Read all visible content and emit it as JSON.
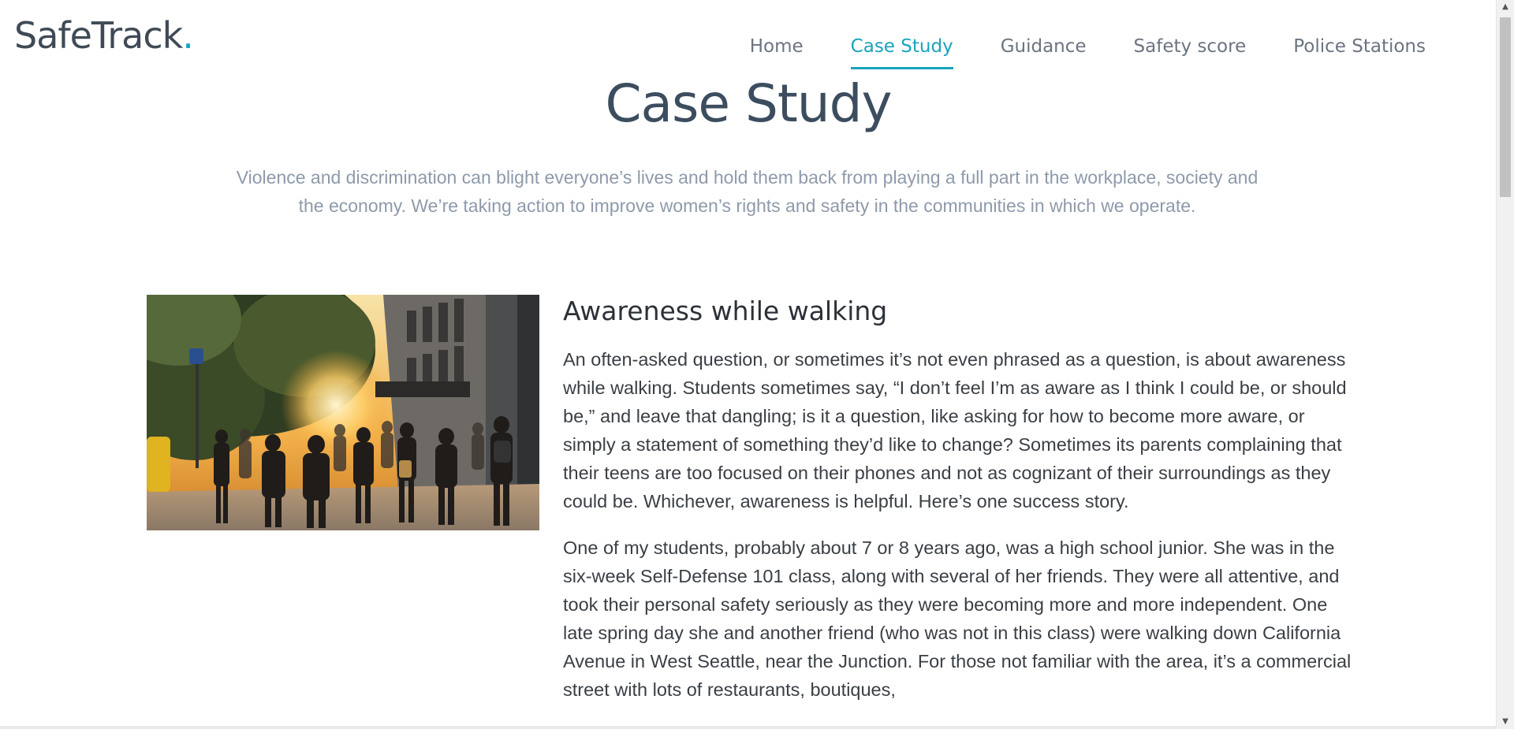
{
  "brand": {
    "name": "SafeTrack",
    "dot": ".",
    "accent_color": "#1aa3bc"
  },
  "nav": {
    "items": [
      {
        "label": "Home",
        "active": false
      },
      {
        "label": "Case Study",
        "active": true
      },
      {
        "label": "Guidance",
        "active": false
      },
      {
        "label": "Safety score",
        "active": false
      },
      {
        "label": "Police Stations",
        "active": false
      }
    ]
  },
  "page": {
    "title": "Case Study",
    "intro": "Violence and discrimination can blight everyone’s lives and hold them back from playing a full part in the workplace, society and the economy. We’re taking action to improve women’s rights and safety in the communities in which we operate."
  },
  "article": {
    "image_alt": "People walking on a city sidewalk at sunset",
    "heading": "Awareness while walking",
    "paragraphs": [
      "An often-asked question, or sometimes it’s not even phrased as a question, is about awareness while walking. Students sometimes say, “I don’t feel I’m as aware as I think I could be, or should be,” and leave that dangling; is it a question, like asking for how to become more aware, or simply a statement of something they’d like to change? Sometimes its parents complaining that their teens are too focused on their phones and not as cognizant of their surroundings as they could be. Whichever, awareness is helpful. Here’s one success story.",
      "One of my students, probably about 7 or 8 years ago, was a high school junior. She was in the six-week Self-Defense 101 class, along with several of her friends. They were all attentive, and took their personal safety seriously as they were becoming more and more independent. One late spring day she and another friend (who was not in this class) were walking down California Avenue in West Seattle, near the Junction. For those not familiar with the area, it’s a commercial street with lots of restaurants, boutiques,"
    ]
  },
  "scrollbar": {
    "up_icon": "▲",
    "down_icon": "▼"
  }
}
